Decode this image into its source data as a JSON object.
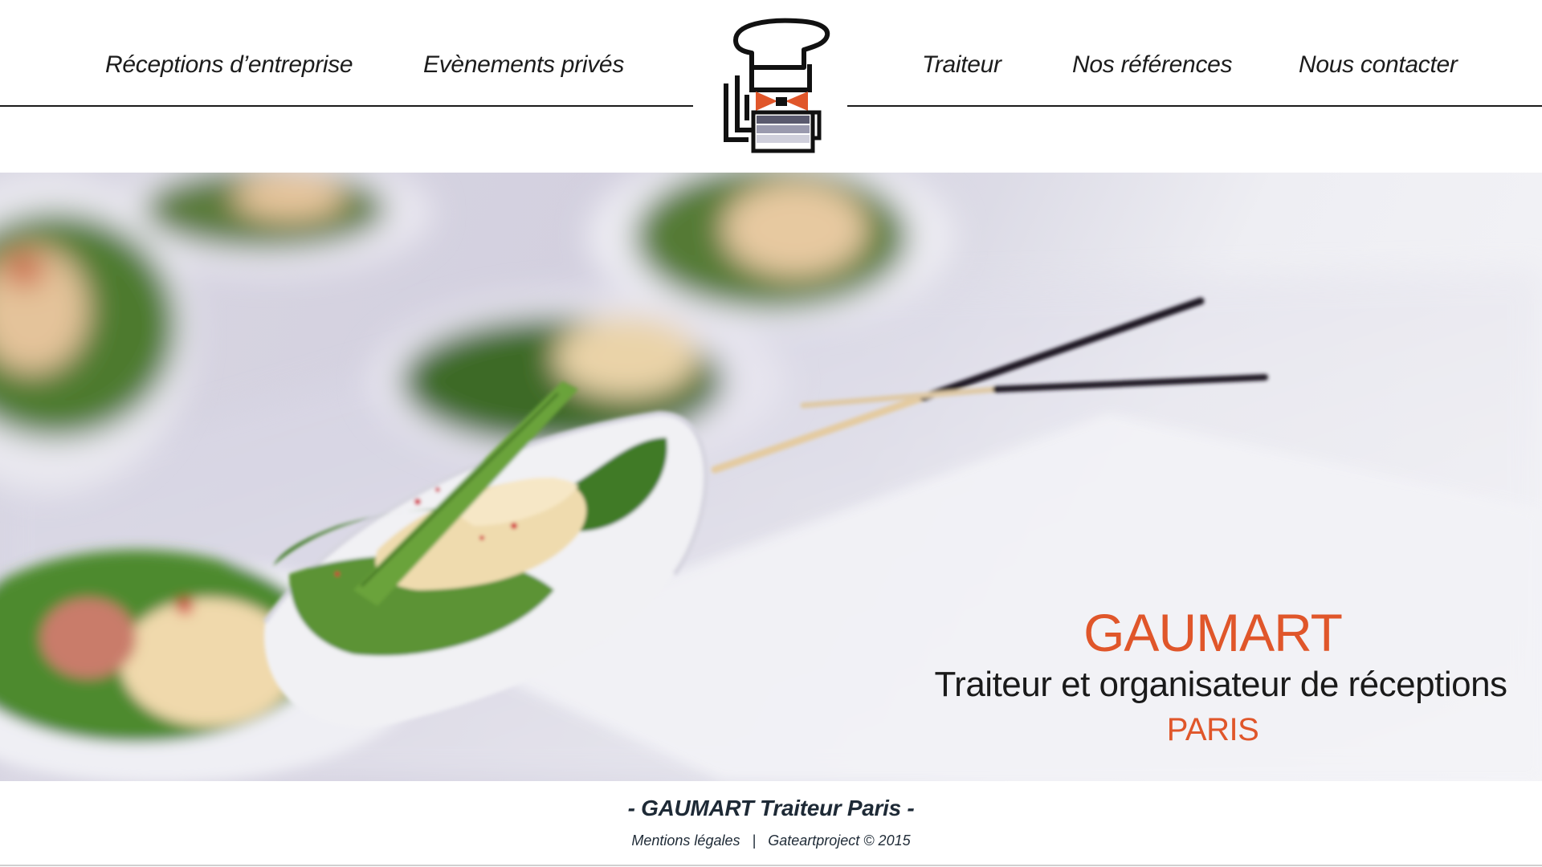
{
  "nav": {
    "items": [
      {
        "label": "Réceptions d’entreprise"
      },
      {
        "label": "Evènements privés"
      },
      {
        "label": "Traiteur"
      },
      {
        "label": "Nos références"
      },
      {
        "label": "Nous contacter"
      }
    ]
  },
  "logo": {
    "icon": "chef-hat-bowtie-logo",
    "colors": {
      "ink": "#111111",
      "accent": "#e0562a",
      "plate": "#8a8aa0"
    }
  },
  "hero": {
    "image": "food-appetizers-photo",
    "brand": "GAUMART",
    "tagline": "Traiteur et organisateur de réceptions",
    "city": "PARIS"
  },
  "footer": {
    "title": "- GAUMART Traiteur Paris -",
    "links": [
      {
        "label": "Mentions légales"
      },
      {
        "label": "Gateartproject © 2015"
      }
    ],
    "separator": "|"
  },
  "colors": {
    "accent": "#e0562a",
    "text": "#1a1a1a",
    "footer_text": "#1e2a36"
  }
}
